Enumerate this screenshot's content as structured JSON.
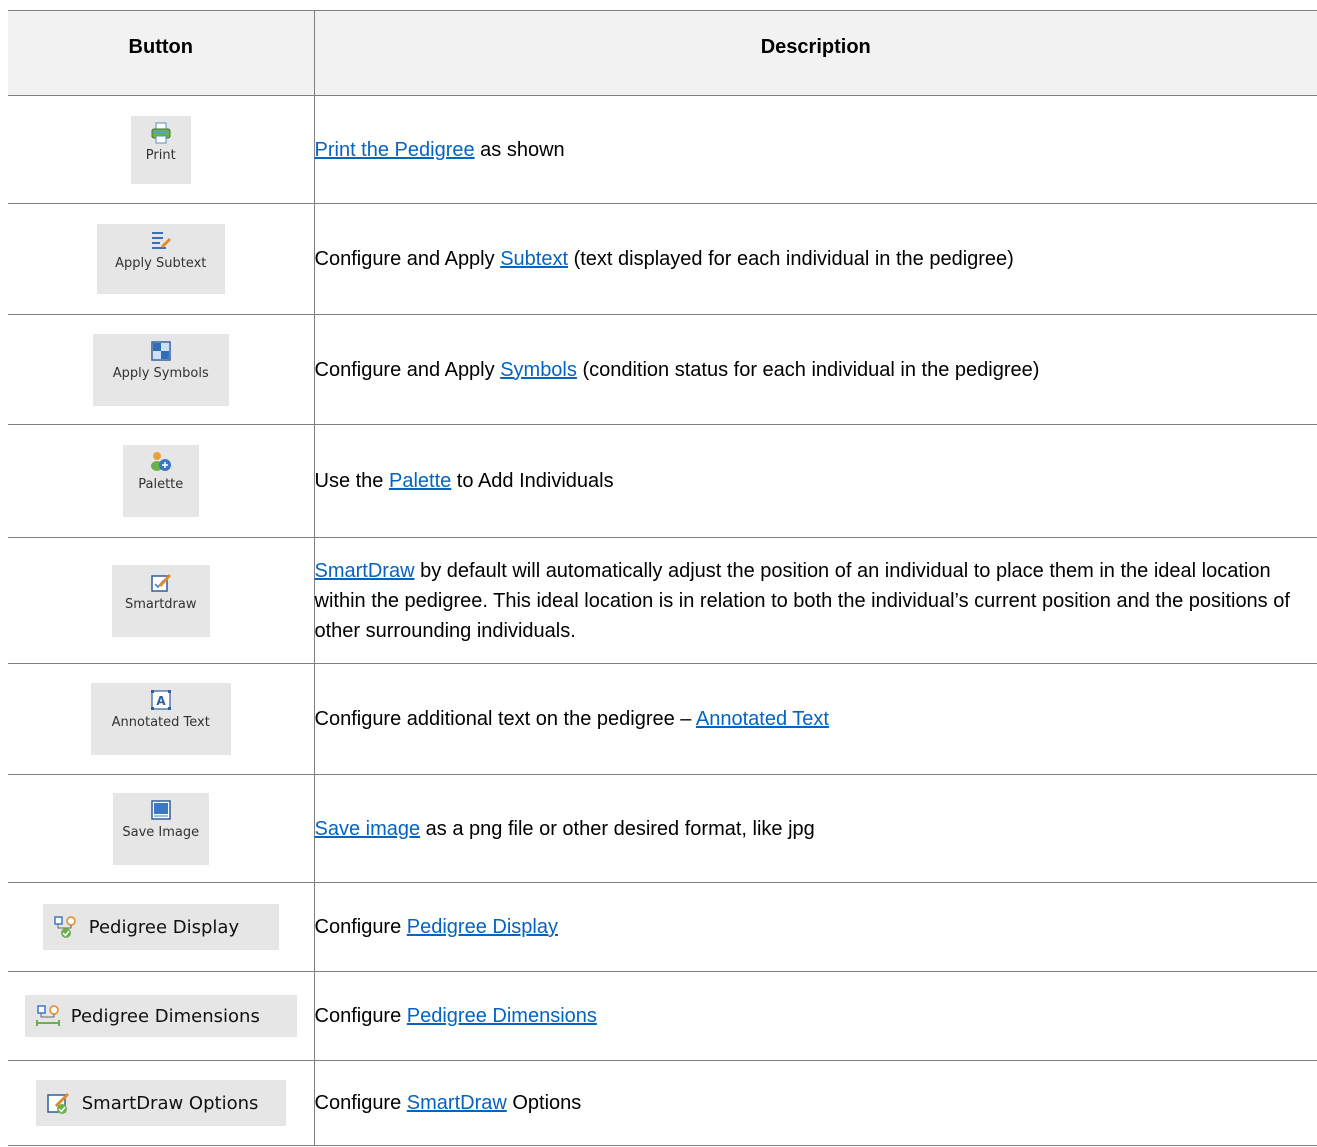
{
  "table": {
    "headers": {
      "button": "Button",
      "description": "Description"
    },
    "rows": [
      {
        "button_label": "Print",
        "icon": "printer-icon",
        "desc_before": "",
        "link": "Print the Pedigree",
        "desc_after": " as shown"
      },
      {
        "button_label": "Apply Subtext",
        "icon": "subtext-pencil-icon",
        "desc_before": "Configure and Apply ",
        "link": "Subtext",
        "desc_after": " (text displayed for each individual in the pedigree)"
      },
      {
        "button_label": "Apply Symbols",
        "icon": "symbols-grid-icon",
        "desc_before": "Configure and Apply ",
        "link": "Symbols",
        "desc_after": " (condition status for each individual in the pedigree)"
      },
      {
        "button_label": "Palette",
        "icon": "palette-people-icon",
        "desc_before": "Use the ",
        "link": "Palette",
        "desc_after": " to Add Individuals"
      },
      {
        "button_label": "Smartdraw",
        "icon": "smartdraw-pencil-icon",
        "desc_before": "",
        "link": "SmartDraw",
        "desc_after": " by default will automatically adjust the position of an individual to place them in the ideal location within the pedigree. This ideal location is in relation to both the individual’s current position and the positions of other surrounding individuals."
      },
      {
        "button_label": "Annotated Text",
        "icon": "annotated-text-icon",
        "desc_before": "Configure additional text on the pedigree – ",
        "link": "Annotated Text",
        "desc_after": ""
      },
      {
        "button_label": "Save Image",
        "icon": "save-image-icon",
        "desc_before": "",
        "link": "Save image",
        "desc_after": " as a png file or other desired format, like jpg"
      },
      {
        "button_label": "Pedigree Display",
        "icon": "pedigree-display-icon",
        "desc_before": "Configure ",
        "link": "Pedigree Display",
        "desc_after": ""
      },
      {
        "button_label": "Pedigree Dimensions",
        "icon": "pedigree-dimensions-icon",
        "desc_before": "Configure ",
        "link": "Pedigree Dimensions",
        "desc_after": ""
      },
      {
        "button_label": "SmartDraw Options",
        "icon": "smartdraw-options-icon",
        "desc_before": "Configure ",
        "link": "SmartDraw",
        "desc_after": " Options"
      }
    ]
  },
  "colors": {
    "link": "#0563c1",
    "header_bg": "#f2f2f2",
    "button_bg": "#e6e6e6",
    "border": "#7f7f7f"
  }
}
